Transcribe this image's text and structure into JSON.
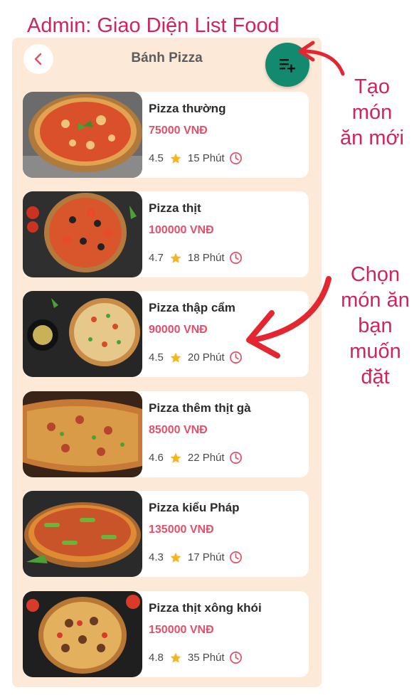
{
  "caption": "Admin: Giao Diện List Food",
  "header": {
    "title": "Bánh Pizza",
    "back_icon": "chevron-left-icon",
    "add_icon": "add-to-list-icon"
  },
  "colors": {
    "accent": "#138a70",
    "price": "#e0506a",
    "annotation": "#d1235f",
    "panel": "#fde9d7",
    "star": "#f5b51d"
  },
  "items": [
    {
      "name": "Pizza thường",
      "price": "75000 VNĐ",
      "rating": "4.5",
      "time": "15 Phút"
    },
    {
      "name": "Pizza thịt",
      "price": "100000 VNĐ",
      "rating": "4.7",
      "time": "18 Phút"
    },
    {
      "name": "Pizza thập cẩm",
      "price": "90000 VNĐ",
      "rating": "4.5",
      "time": "20 Phút"
    },
    {
      "name": "Pizza thêm thịt gà",
      "price": "85000 VNĐ",
      "rating": "4.6",
      "time": "22 Phút"
    },
    {
      "name": "Pizza kiểu Pháp",
      "price": "135000 VNĐ",
      "rating": "4.3",
      "time": "17 Phút"
    },
    {
      "name": "Pizza thịt xông khói",
      "price": "150000 VNĐ",
      "rating": "4.8",
      "time": "35 Phút"
    }
  ],
  "annotations": {
    "create": [
      "Tạo",
      "món",
      "ăn mới"
    ],
    "choose": [
      "Chọn",
      "món ăn",
      "bạn",
      "muốn",
      "đặt"
    ]
  }
}
